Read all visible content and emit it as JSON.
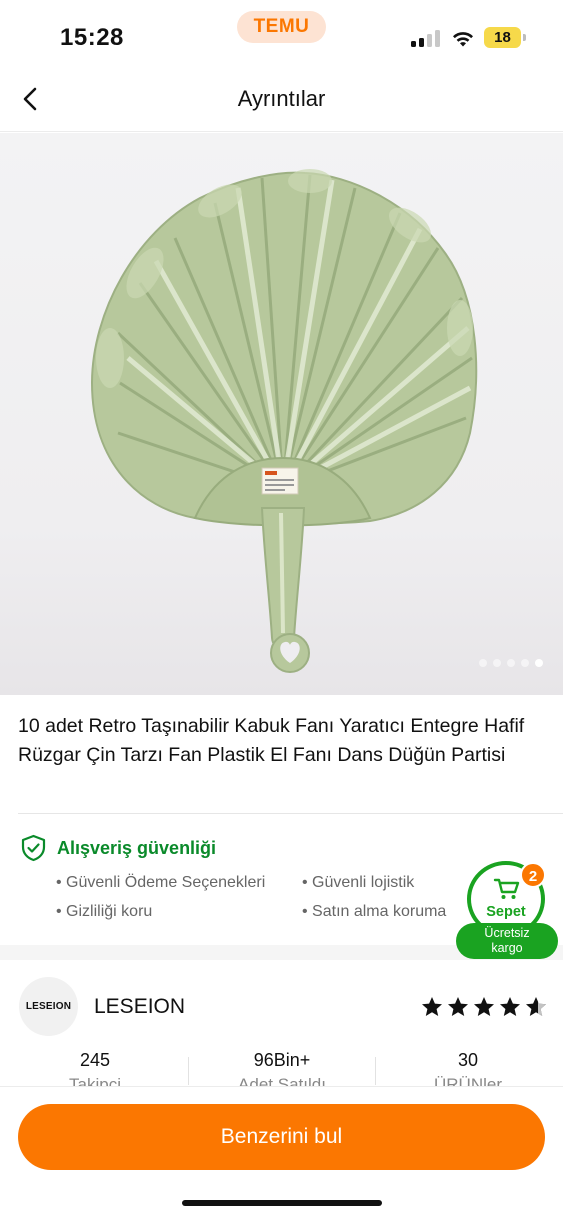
{
  "status_bar": {
    "time": "15:28",
    "app_badge": "TEMU",
    "battery_level": "18",
    "signal_bars_active": 2,
    "signal_bars_total": 4
  },
  "nav": {
    "back_icon": "chevron-left-icon",
    "title": "Ayrıntılar"
  },
  "product": {
    "image_label": "green-shell-hand-fan-photo",
    "carousel_total": 5,
    "carousel_active_index": 5,
    "title": "10 adet Retro Taşınabilir Kabuk Fanı Yaratıcı Entegre Hafif Rüzgar Çin Tarzı Fan Plastik El Fanı Dans Düğün Partisi"
  },
  "security": {
    "icon": "shield-check-icon",
    "title": "Alışveriş güvenliği",
    "items": [
      "• Güvenli Ödeme Seçenekleri",
      "• Güvenli lojistik",
      "• Gizliliği koru",
      "• Satın alma koruma"
    ]
  },
  "cart": {
    "icon": "cart-icon",
    "label": "Sepet",
    "badge_count": "2",
    "free_shipping_line1": "Ücretsiz",
    "free_shipping_line2": "kargo"
  },
  "store": {
    "logo_text": "LESEION",
    "name": "LESEION",
    "rating": 4.5,
    "stats": [
      {
        "value": "245",
        "label": "Takipçi"
      },
      {
        "value": "96Bin+",
        "label": "Adet Satıldı"
      },
      {
        "value": "30",
        "label": "ÜRÜNler"
      }
    ]
  },
  "bottom": {
    "button_label": "Benzerini bul"
  },
  "colors": {
    "brand_orange": "#fb7701",
    "security_green": "#0a8a2a",
    "cart_green": "#1aa321",
    "fan_green": "#b9c99f"
  }
}
